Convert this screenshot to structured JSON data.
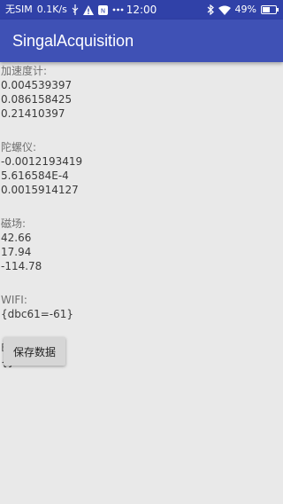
{
  "status_bar": {
    "carrier": "无SIM",
    "speed": "0.1K/s",
    "time": "12:00",
    "battery": "49%",
    "icons": [
      "usb-icon",
      "warning-icon",
      "notification-icon",
      "more-icon",
      "bluetooth-icon",
      "wifi-icon",
      "battery-icon"
    ]
  },
  "app_bar": {
    "title": "SingalAcquisition",
    "color": "#3f51b5"
  },
  "sensors": {
    "accelerometer": {
      "label": "加速度计:",
      "values": [
        "0.004539397",
        "0.086158425",
        "0.21410397"
      ]
    },
    "gyroscope": {
      "label": "陀螺仪:",
      "values": [
        "-0.0012193419",
        "5.616584E-4",
        "0.0015914127"
      ]
    },
    "magnetometer": {
      "label": "磁场:",
      "values": [
        "42.66",
        "17.94",
        "-114.78"
      ]
    },
    "wifi": {
      "label": "WIFI:",
      "value": "{dbc61=-61}"
    },
    "bluetooth": {
      "label": "Bluetooth:",
      "value": "{}"
    }
  },
  "actions": {
    "save_label": "保存数据"
  }
}
